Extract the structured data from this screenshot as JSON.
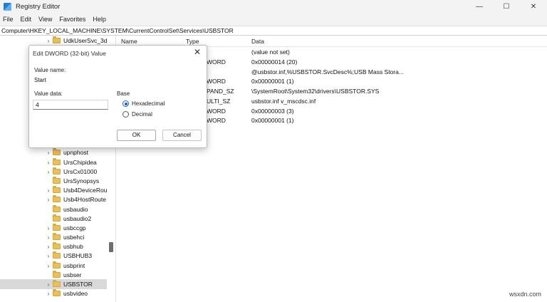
{
  "window": {
    "title": "Registry Editor",
    "controls": {
      "minimize": "—",
      "maximize": "☐",
      "close": "✕"
    }
  },
  "menu": [
    "File",
    "Edit",
    "View",
    "Favorites",
    "Help"
  ],
  "address": "Computer\\HKEY_LOCAL_MACHINE\\SYSTEM\\CurrentControlSet\\Services\\USBSTOR",
  "tree": {
    "items": [
      {
        "label": "UdkUserSvc_3d",
        "expandable": true,
        "selected": false
      },
      {
        "label": "upnphost",
        "expandable": true,
        "selected": false
      },
      {
        "label": "UrsChipidea",
        "expandable": true,
        "selected": false
      },
      {
        "label": "UrsCx01000",
        "expandable": true,
        "selected": false
      },
      {
        "label": "UrsSynopsys",
        "expandable": false,
        "selected": false
      },
      {
        "label": "Usb4DeviceRou",
        "expandable": true,
        "selected": false
      },
      {
        "label": "Usb4HostRoute",
        "expandable": true,
        "selected": false
      },
      {
        "label": "usbaudio",
        "expandable": false,
        "selected": false
      },
      {
        "label": "usbaudio2",
        "expandable": false,
        "selected": false
      },
      {
        "label": "usbccgp",
        "expandable": true,
        "selected": false
      },
      {
        "label": "usbehci",
        "expandable": true,
        "selected": false
      },
      {
        "label": "usbhub",
        "expandable": true,
        "selected": false
      },
      {
        "label": "USBHUB3",
        "expandable": true,
        "selected": false
      },
      {
        "label": "usbprint",
        "expandable": true,
        "selected": false
      },
      {
        "label": "usbser",
        "expandable": false,
        "selected": false
      },
      {
        "label": "USBSTOR",
        "expandable": true,
        "selected": true
      },
      {
        "label": "usbvideo",
        "expandable": true,
        "selected": false
      }
    ]
  },
  "list": {
    "headers": {
      "name": "Name",
      "type": "Type",
      "data": "Data"
    },
    "rows": [
      {
        "type": "",
        "data": "(value not set)"
      },
      {
        "type": "WORD",
        "data": "0x00000014 (20)"
      },
      {
        "type": "",
        "data": "@usbstor.inf,%USBSTOR.SvcDesc%;USB Mass Stora..."
      },
      {
        "type": "WORD",
        "data": "0x00000001 (1)"
      },
      {
        "type": "PAND_SZ",
        "data": "\\SystemRoot\\System32\\drivers\\USBSTOR.SYS"
      },
      {
        "type": "ULTI_SZ",
        "data": "usbstor.inf v_mscdsc.inf"
      },
      {
        "type": "WORD",
        "data": "0x00000003 (3)"
      },
      {
        "type": "WORD",
        "data": "0x00000001 (1)"
      }
    ]
  },
  "dialog": {
    "title": "Edit DWORD (32-bit) Value",
    "close": "✕",
    "value_name_label": "Value name:",
    "value_name": "Start",
    "value_data_label": "Value data:",
    "value_data": "4",
    "base_label": "Base",
    "radio_hex": "Hexadecimal",
    "radio_dec": "Decimal",
    "selected_base": "Hexadecimal",
    "ok": "OK",
    "cancel": "Cancel"
  },
  "watermark": "wsxdn.com",
  "colors": {
    "chrome": "#f3f3f3",
    "folder": "#e8c15b",
    "selection": "#d9d9d9",
    "radio_accent": "#1f5fbf"
  }
}
